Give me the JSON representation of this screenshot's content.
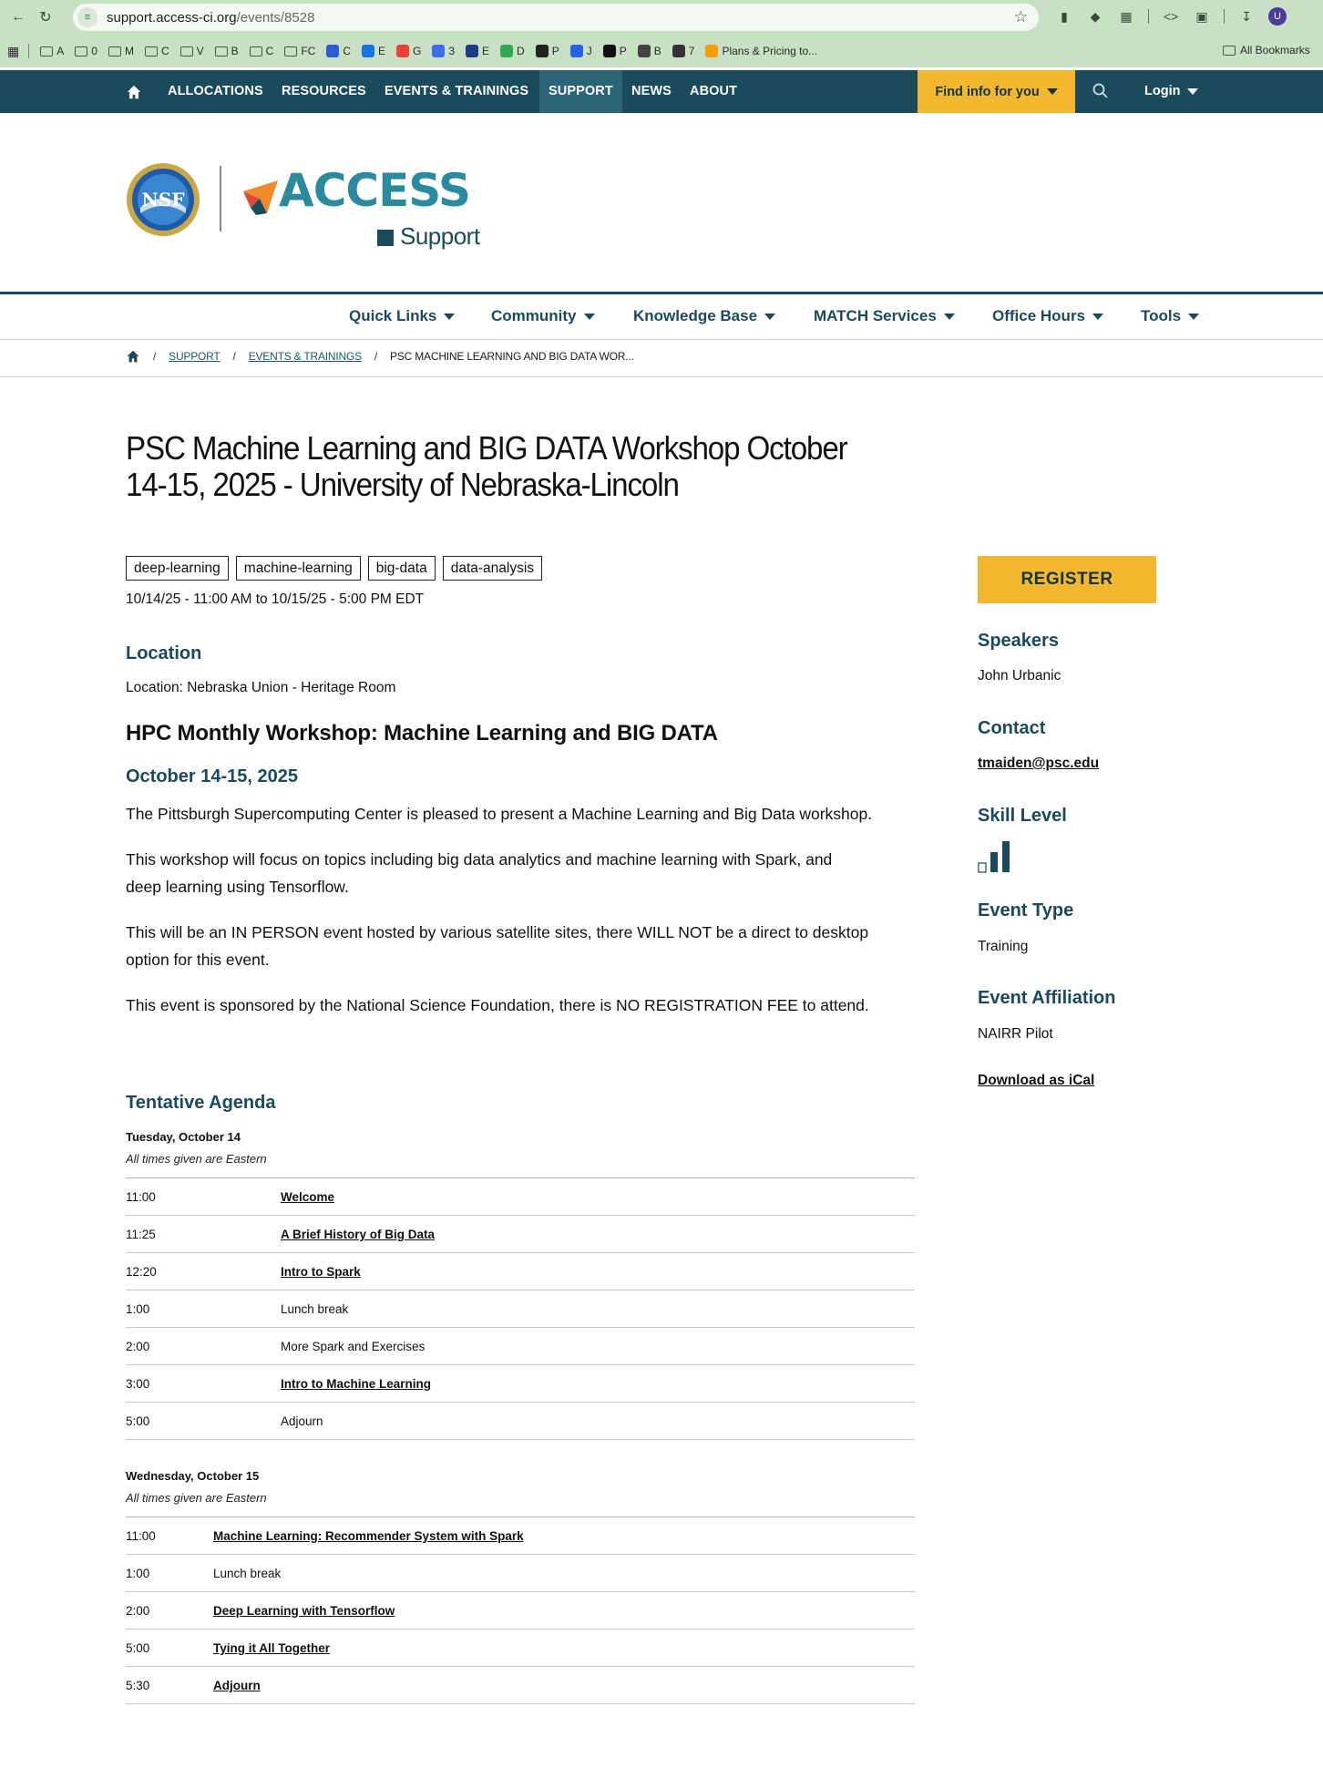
{
  "browser": {
    "url_host": "support.access-ci.org",
    "url_path": "/events/8528",
    "profile_initial": "U",
    "bookmarks": [
      {
        "label": "A",
        "kind": "folder"
      },
      {
        "label": "0",
        "kind": "folder"
      },
      {
        "label": "M",
        "kind": "folder"
      },
      {
        "label": "C",
        "kind": "folder"
      },
      {
        "label": "V",
        "kind": "folder"
      },
      {
        "label": "B",
        "kind": "folder"
      },
      {
        "label": "C",
        "kind": "folder"
      },
      {
        "label": "FC",
        "kind": "folder"
      },
      {
        "label": "C",
        "kind": "fav",
        "color": "#2a5bd7"
      },
      {
        "label": "E",
        "kind": "fav",
        "color": "#1a73e8"
      },
      {
        "label": "G",
        "kind": "fav",
        "color": "#ea4335"
      },
      {
        "label": "3",
        "kind": "fav",
        "color": "#3b6ee8"
      },
      {
        "label": "E",
        "kind": "fav",
        "color": "#1e3a8a"
      },
      {
        "label": "D",
        "kind": "fav",
        "color": "#34a853"
      },
      {
        "label": "P",
        "kind": "fav",
        "color": "#222222"
      },
      {
        "label": "J",
        "kind": "fav",
        "color": "#2563eb"
      },
      {
        "label": "P",
        "kind": "fav",
        "color": "#111111"
      },
      {
        "label": "B",
        "kind": "fav",
        "color": "#444444"
      },
      {
        "label": "7",
        "kind": "fav",
        "color": "#333333"
      },
      {
        "label": "Plans & Pricing to...",
        "kind": "fav",
        "color": "#f59e0b"
      }
    ],
    "all_bookmarks_label": "All Bookmarks"
  },
  "site_nav": {
    "items": [
      "ALLOCATIONS",
      "RESOURCES",
      "EVENTS & TRAININGS",
      "SUPPORT",
      "NEWS",
      "ABOUT"
    ],
    "active": "SUPPORT",
    "find_info": "Find info for you",
    "login": "Login"
  },
  "logo": {
    "seal_text": "NSF",
    "brand": "ACCESS",
    "sub": "Support"
  },
  "sub_nav": {
    "items": [
      "Quick Links",
      "Community",
      "Knowledge Base",
      "MATCH Services",
      "Office Hours",
      "Tools"
    ]
  },
  "breadcrumb": {
    "items": [
      "SUPPORT",
      "EVENTS & TRAININGS"
    ],
    "current": "PSC MACHINE LEARNING AND BIG DATA WOR..."
  },
  "event": {
    "title": "PSC Machine Learning and BIG DATA Workshop October 14-15, 2025 - University of Nebraska-Lincoln",
    "tags": [
      "deep-learning",
      "machine-learning",
      "big-data",
      "data-analysis"
    ],
    "datetime": "10/14/25 - 11:00 AM to 10/15/25 - 5:00 PM EDT",
    "location_heading": "Location",
    "location": "Location: Nebraska Union - Heritage Room",
    "workshop_heading": "HPC Monthly Workshop: Machine Learning and BIG DATA",
    "dates_heading": "October 14-15, 2025",
    "paragraphs": [
      "The Pittsburgh Supercomputing Center is pleased to present a Machine Learning and Big Data workshop.",
      "This workshop will focus on topics including big data analytics and machine learning with Spark, and deep learning using Tensorflow.",
      "This will be an IN PERSON event hosted by various satellite sites, there WILL NOT be a direct to desktop option for this event.",
      "This event is sponsored by the National Science Foundation, there is NO REGISTRATION FEE to attend."
    ]
  },
  "agenda": {
    "heading": "Tentative Agenda",
    "days": [
      {
        "label": "Tuesday, October 14",
        "note": "All times given are Eastern",
        "rows": [
          {
            "time": "11:00",
            "title": "Welcome",
            "link": true
          },
          {
            "time": "11:25",
            "title": "A Brief History of  Big Data",
            "link": true
          },
          {
            "time": "12:20",
            "title": "Intro to Spark",
            "link": true
          },
          {
            "time": "1:00",
            "title": "Lunch break",
            "link": false
          },
          {
            "time": "2:00",
            "title": "More Spark and Exercises",
            "link": false
          },
          {
            "time": "3:00",
            "title": "Intro to Machine Learning",
            "link": true
          },
          {
            "time": "5:00",
            "title": "Adjourn",
            "link": false
          }
        ]
      },
      {
        "label": "Wednesday, October 15",
        "note": "All times given are Eastern",
        "rows": [
          {
            "time": "11:00",
            "title": "Machine Learning: Recommender System with Spark",
            "link": true
          },
          {
            "time": "1:00",
            "title": "Lunch break",
            "link": false
          },
          {
            "time": "2:00",
            "title": "Deep Learning with Tensorflow",
            "link": true
          },
          {
            "time": "5:00",
            "title": "Tying it All Together",
            "link": true
          },
          {
            "time": "5:30",
            "title": "Adjourn",
            "link": true
          }
        ]
      }
    ]
  },
  "sidebar": {
    "register": "REGISTER",
    "speakers_heading": "Speakers",
    "speakers": "John Urbanic",
    "contact_heading": "Contact",
    "contact": "tmaiden@psc.edu",
    "skill_heading": "Skill Level",
    "skill_level": {
      "filled": 2,
      "total": 3
    },
    "type_heading": "Event Type",
    "type": "Training",
    "affiliation_heading": "Event Affiliation",
    "affiliation": "NAIRR Pilot",
    "ical": "Download as iCal"
  },
  "colors": {
    "nav_bg": "#1a4a5c",
    "accent": "#f4b730",
    "heading": "#1a4a5c"
  }
}
